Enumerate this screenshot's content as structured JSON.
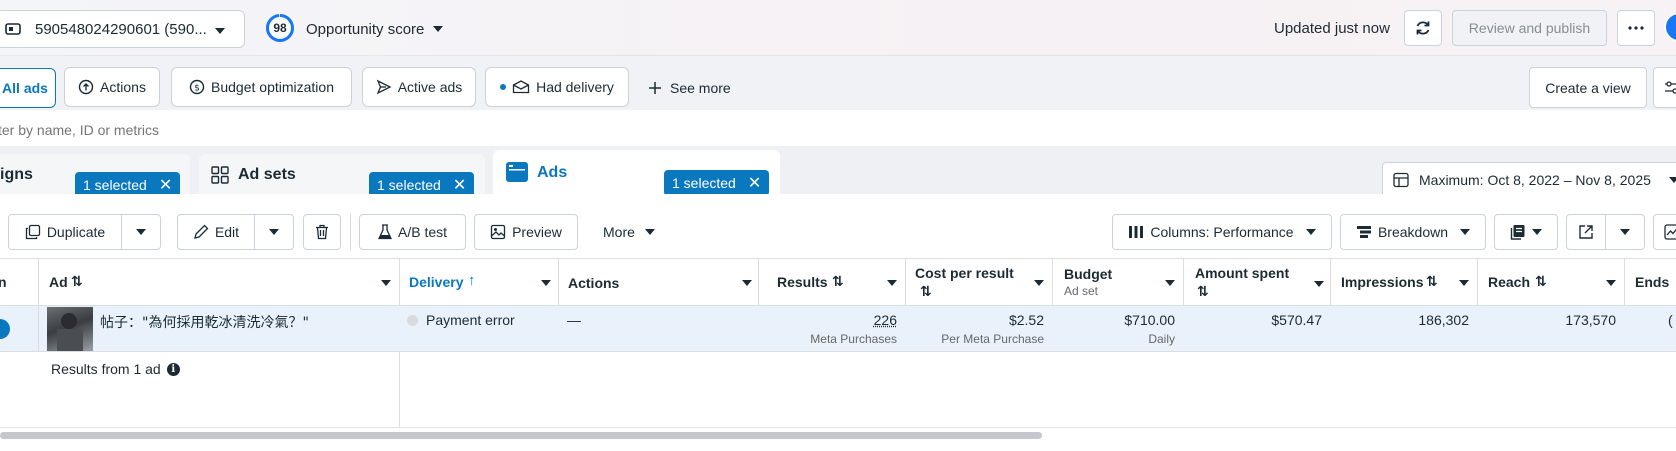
{
  "topbar": {
    "account_name": "590548024290601 (590...",
    "opportunity_score": "98",
    "opportunity_label": "Opportunity score",
    "updated_text": "Updated just now",
    "review_publish": "Review and publish"
  },
  "filters": {
    "all_ads": "All ads",
    "actions": "Actions",
    "budget_optimization": "Budget optimization",
    "active_ads": "Active ads",
    "had_delivery": "Had delivery",
    "see_more": "See more",
    "create_view": "Create a view"
  },
  "search": {
    "placeholder": "ter by name, ID or metrics"
  },
  "tabs": {
    "campaigns": {
      "label": "igns",
      "selected": "1 selected"
    },
    "adsets": {
      "label": "Ad sets",
      "selected": "1 selected"
    },
    "ads": {
      "label": "Ads",
      "selected": "1 selected"
    },
    "date_range": "Maximum: Oct 8, 2022 – Nov 8, 2025"
  },
  "toolbar": {
    "duplicate": "Duplicate",
    "edit": "Edit",
    "ab_test": "A/B test",
    "preview": "Preview",
    "more": "More",
    "columns": "Columns: Performance",
    "breakdown": "Breakdown"
  },
  "table": {
    "headers": {
      "first": "n",
      "ad": "Ad",
      "delivery": "Delivery",
      "actions": "Actions",
      "results": "Results",
      "cost_per_result": "Cost per result",
      "budget": "Budget",
      "budget_sub": "Ad set",
      "amount_spent": "Amount spent",
      "impressions": "Impressions",
      "reach": "Reach",
      "ends": "Ends"
    },
    "row": {
      "ad_name": "帖子：\"為何採用乾冰清洗冷氣？\"",
      "delivery": "Payment error",
      "actions": "—",
      "results": "226",
      "results_sub": "Meta Purchases",
      "cost_per_result": "$2.52",
      "cost_sub": "Per Meta Purchase",
      "budget": "$710.00",
      "budget_sub": "Daily",
      "amount_spent": "$570.47",
      "impressions": "186,302",
      "reach": "173,570",
      "ends": "("
    },
    "footer": "Results from 1 ad"
  },
  "colors": {
    "accent": "#0a78be",
    "row_highlight": "#e9f2fb"
  }
}
